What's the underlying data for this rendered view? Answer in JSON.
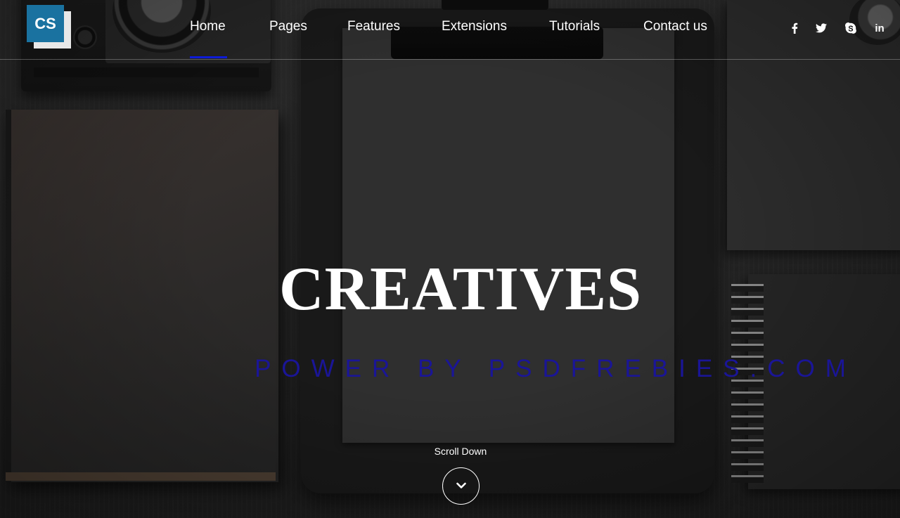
{
  "brand": {
    "logo_text": "CS",
    "accent": "#1a72a0"
  },
  "nav": {
    "items": [
      {
        "label": "Home",
        "active": true
      },
      {
        "label": "Pages"
      },
      {
        "label": "Features"
      },
      {
        "label": "Extensions"
      },
      {
        "label": "Tutorials"
      },
      {
        "label": "Contact us"
      }
    ],
    "active_indicator_color": "#0d1bd8"
  },
  "social": {
    "icons": [
      "facebook-icon",
      "twitter-icon",
      "skype-icon",
      "linkedin-icon"
    ],
    "linkedin_text": "in"
  },
  "hero": {
    "title": "CREATIVES",
    "subtitle": "POWER BY PSDFREBIES.COM",
    "subtitle_color": "#1a1597"
  },
  "scroll": {
    "label": "Scroll Down",
    "icon": "chevron-down-icon"
  }
}
